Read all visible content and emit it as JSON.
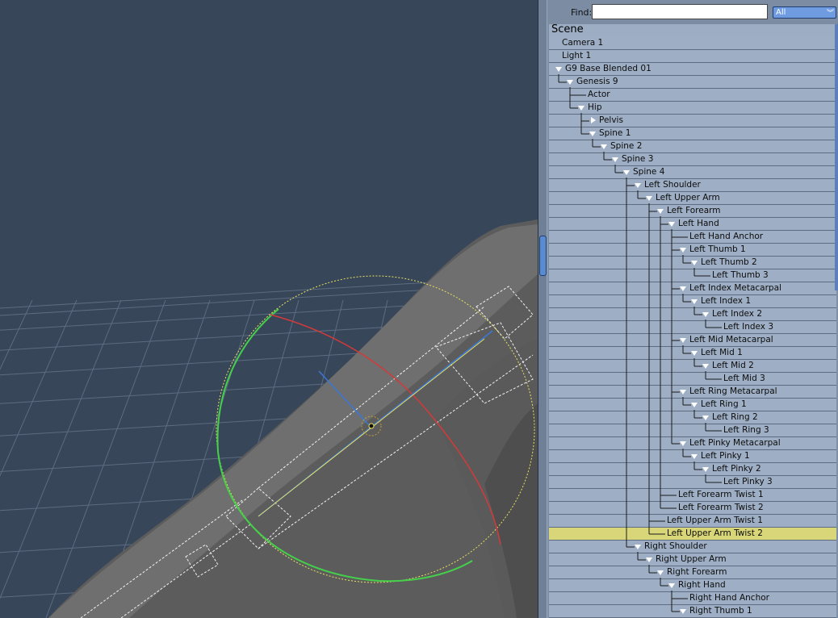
{
  "find": {
    "label": "Find:",
    "value": "",
    "filter": "All"
  },
  "scene_header": "Scene",
  "tree": [
    {
      "label": "Camera 1",
      "depth": 0,
      "toggle": "none"
    },
    {
      "label": "Light 1",
      "depth": 0,
      "toggle": "none"
    },
    {
      "label": "G9 Base Blended 01",
      "depth": 0,
      "toggle": "open"
    },
    {
      "label": "Genesis 9",
      "depth": 1,
      "toggle": "open"
    },
    {
      "label": "Actor",
      "depth": 2,
      "toggle": "none"
    },
    {
      "label": "Hip",
      "depth": 2,
      "toggle": "open"
    },
    {
      "label": "Pelvis",
      "depth": 3,
      "toggle": "closed"
    },
    {
      "label": "Spine 1",
      "depth": 3,
      "toggle": "open"
    },
    {
      "label": "Spine 2",
      "depth": 4,
      "toggle": "open"
    },
    {
      "label": "Spine 3",
      "depth": 5,
      "toggle": "open"
    },
    {
      "label": "Spine 4",
      "depth": 6,
      "toggle": "open"
    },
    {
      "label": "Left Shoulder",
      "depth": 7,
      "toggle": "open"
    },
    {
      "label": "Left Upper Arm",
      "depth": 8,
      "toggle": "open"
    },
    {
      "label": "Left Forearm",
      "depth": 9,
      "toggle": "open"
    },
    {
      "label": "Left Hand",
      "depth": 10,
      "toggle": "open"
    },
    {
      "label": "Left Hand Anchor",
      "depth": 11,
      "toggle": "none"
    },
    {
      "label": "Left Thumb 1",
      "depth": 11,
      "toggle": "open"
    },
    {
      "label": "Left Thumb 2",
      "depth": 12,
      "toggle": "open"
    },
    {
      "label": "Left Thumb 3",
      "depth": 13,
      "toggle": "none"
    },
    {
      "label": "Left Index Metacarpal",
      "depth": 11,
      "toggle": "open"
    },
    {
      "label": "Left Index 1",
      "depth": 12,
      "toggle": "open"
    },
    {
      "label": "Left Index 2",
      "depth": 13,
      "toggle": "open"
    },
    {
      "label": "Left Index 3",
      "depth": 14,
      "toggle": "none"
    },
    {
      "label": "Left Mid Metacarpal",
      "depth": 11,
      "toggle": "open"
    },
    {
      "label": "Left Mid 1",
      "depth": 12,
      "toggle": "open"
    },
    {
      "label": "Left Mid 2",
      "depth": 13,
      "toggle": "open"
    },
    {
      "label": "Left Mid 3",
      "depth": 14,
      "toggle": "none"
    },
    {
      "label": "Left Ring Metacarpal",
      "depth": 11,
      "toggle": "open"
    },
    {
      "label": "Left Ring 1",
      "depth": 12,
      "toggle": "open"
    },
    {
      "label": "Left Ring 2",
      "depth": 13,
      "toggle": "open"
    },
    {
      "label": "Left Ring 3",
      "depth": 14,
      "toggle": "none"
    },
    {
      "label": "Left Pinky Metacarpal",
      "depth": 11,
      "toggle": "open"
    },
    {
      "label": "Left Pinky 1",
      "depth": 12,
      "toggle": "open"
    },
    {
      "label": "Left Pinky 2",
      "depth": 13,
      "toggle": "open"
    },
    {
      "label": "Left Pinky 3",
      "depth": 14,
      "toggle": "none"
    },
    {
      "label": "Left Forearm Twist 1",
      "depth": 10,
      "toggle": "none"
    },
    {
      "label": "Left Forearm Twist 2",
      "depth": 10,
      "toggle": "none"
    },
    {
      "label": "Left Upper Arm Twist 1",
      "depth": 9,
      "toggle": "none"
    },
    {
      "label": "Left Upper Arm Twist 2",
      "depth": 9,
      "toggle": "none",
      "selected": true
    },
    {
      "label": "Right Shoulder",
      "depth": 7,
      "toggle": "open"
    },
    {
      "label": "Right Upper Arm",
      "depth": 8,
      "toggle": "open"
    },
    {
      "label": "Right Forearm",
      "depth": 9,
      "toggle": "open"
    },
    {
      "label": "Right Hand",
      "depth": 10,
      "toggle": "open"
    },
    {
      "label": "Right Hand Anchor",
      "depth": 11,
      "toggle": "none"
    },
    {
      "label": "Right Thumb 1",
      "depth": 11,
      "toggle": "open"
    }
  ],
  "colors": {
    "viewport_bg": "#374659",
    "grid": "#5d6c80",
    "row": "#9eafc5",
    "row_selected": "#d8d679",
    "gizmo_green": "#44d04a",
    "gizmo_red": "#d33a3a",
    "gizmo_yellow": "#e8e060",
    "gizmo_blue": "#3a78d8"
  }
}
